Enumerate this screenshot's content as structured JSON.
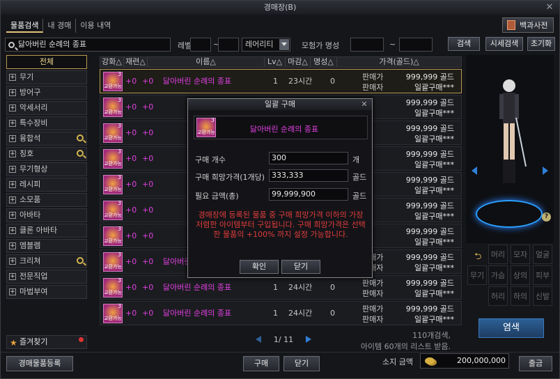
{
  "window": {
    "title": "경매장(B)"
  },
  "tabs": [
    "물품검색",
    "내 경매",
    "이용 내역"
  ],
  "encyclopedia_btn": "백과사전",
  "search": {
    "value": "닳아버린 순례의 종표",
    "level_label": "레벨",
    "tilde": "~",
    "rarity": "레어리티",
    "adventurer_label": "모험가 명성",
    "search_btn": "검색",
    "market_btn": "시세검색",
    "reset_btn": "초기화"
  },
  "sidebar": {
    "items": [
      {
        "label": "전체",
        "active": true,
        "plus": false,
        "zoom": false
      },
      {
        "label": "무기",
        "plus": true
      },
      {
        "label": "방어구",
        "plus": true
      },
      {
        "label": "악세서리",
        "plus": true
      },
      {
        "label": "특수장비",
        "plus": true
      },
      {
        "label": "융합석",
        "plus": true,
        "zoom": true
      },
      {
        "label": "칭호",
        "plus": true,
        "zoom": true
      },
      {
        "label": "무기형상",
        "plus": true
      },
      {
        "label": "레시피",
        "plus": true
      },
      {
        "label": "소모품",
        "plus": true
      },
      {
        "label": "아바타",
        "plus": true
      },
      {
        "label": "클론 아바타",
        "plus": true
      },
      {
        "label": "엠블렘",
        "plus": true
      },
      {
        "label": "크리쳐",
        "plus": true,
        "zoom": true
      },
      {
        "label": "전문직업",
        "plus": true
      },
      {
        "label": "마법부여",
        "plus": true
      }
    ],
    "favorites": "즐겨찾기"
  },
  "table": {
    "headers": [
      "강화△",
      "재련△",
      "이름△",
      "Lv△",
      "마감△",
      "명성△",
      "가격(골드)△"
    ],
    "rows": [
      {
        "enh": "+0",
        "ref": "+0",
        "name": "닳아버린 순례의 종표",
        "lv": "1",
        "time": "23시간",
        "fame": "0",
        "price": "999,999 골드",
        "bulk": "일괄구매***",
        "sell": "판매가",
        "seller": "판매자",
        "selected": true
      },
      {
        "enh": "+0",
        "ref": "+0",
        "name": "",
        "lv": "",
        "time": "",
        "fame": "",
        "price": "999,999 골드",
        "bulk": "일괄구매***",
        "sell": "가",
        "seller": "자"
      },
      {
        "enh": "+0",
        "ref": "+0",
        "name": "",
        "lv": "",
        "time": "",
        "fame": "",
        "price": "999,999 골드",
        "bulk": "일괄구매***",
        "sell": "가",
        "seller": "자"
      },
      {
        "enh": "+0",
        "ref": "+0",
        "name": "",
        "lv": "",
        "time": "",
        "fame": "",
        "price": "999,999 골드",
        "bulk": "일괄구매***",
        "sell": "가",
        "seller": "자"
      },
      {
        "enh": "+0",
        "ref": "+0",
        "name": "",
        "lv": "",
        "time": "",
        "fame": "",
        "price": "999,999 골드",
        "bulk": "일괄구매***",
        "sell": "가",
        "seller": "자"
      },
      {
        "enh": "+0",
        "ref": "+0",
        "name": "",
        "lv": "",
        "time": "",
        "fame": "",
        "price": "999,999 골드",
        "bulk": "일괄구매***",
        "sell": "가",
        "seller": "자"
      },
      {
        "enh": "+0",
        "ref": "+0",
        "name": "",
        "lv": "",
        "time": "",
        "fame": "",
        "price": "999,999 골드",
        "bulk": "일괄구매***",
        "sell": "가",
        "seller": "자"
      },
      {
        "enh": "+0",
        "ref": "+0",
        "name": "닳아버린 순례의 종표",
        "lv": "",
        "time": "",
        "fame": "0",
        "price": "999,999 골드",
        "bulk": "일괄구매***",
        "sell": "판매가",
        "seller": "판매자"
      },
      {
        "enh": "+0",
        "ref": "+0",
        "name": "닳아버린 순례의 종표",
        "lv": "1",
        "time": "24시간",
        "fame": "0",
        "price": "999,999 골드",
        "bulk": "일괄구매***",
        "sell": "판매가",
        "seller": "판매자"
      },
      {
        "enh": "+0",
        "ref": "+0",
        "name": "닳아버린 순례의 종표",
        "lv": "1",
        "time": "24시간",
        "fame": "0",
        "price": "999,999 골드",
        "bulk": "일괄구매***",
        "sell": "판매가",
        "seller": "판매자"
      }
    ],
    "icon_num": "3",
    "icon_text": "교환가능"
  },
  "pager": {
    "text": "1/ 11"
  },
  "result_count": "110개검색,",
  "result_note": "아이템 60개의 리스트 받음.",
  "modal": {
    "title": "일괄 구매",
    "item_name": "닳아버린 순례의 종표",
    "qty_label": "구매 개수",
    "qty_value": "300",
    "qty_unit": "개",
    "price_label": "구매 희망가격(1개당)",
    "price_value": "333,333",
    "price_unit": "골드",
    "total_label": "필요 금액(총)",
    "total_value": "99,999,900",
    "total_unit": "골드",
    "note": "경매장에 등록된 물품 중 구매 희망가격 이하의 가장 저렴한 아이템부터 구입됩니다. 구매 희망가격은 선택한 물품의 +100% 까지 설정 가능합니다.",
    "confirm": "확인",
    "close": "닫기"
  },
  "equip_slots": [
    "머리",
    "모자",
    "얼굴",
    "무기",
    "가슴",
    "상의",
    "피부",
    "허리",
    "하의",
    "신발"
  ],
  "dye_btn": "염색",
  "bottom": {
    "register_btn": "경매물품등록",
    "buy_btn": "구매",
    "close_btn": "닫기",
    "gold_label": "소지 금액",
    "gold_value": "200,000,000",
    "withdraw_btn": "출금"
  },
  "colors": {
    "accent": "#b89a52",
    "item_name": "#e040e0",
    "warning": "#e03c3c",
    "dye": "#2c5f95"
  }
}
